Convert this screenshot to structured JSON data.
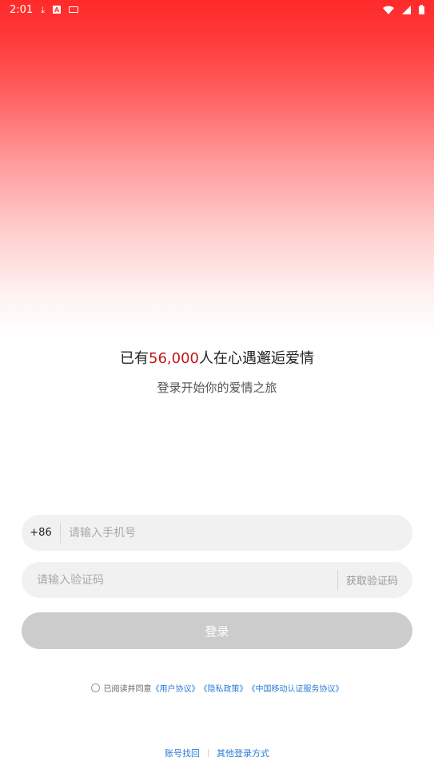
{
  "status_bar": {
    "time": "2:01",
    "icons": [
      "download-icon",
      "a-icon",
      "keyboard-icon",
      "wifi-icon",
      "signal-icon",
      "battery-icon"
    ]
  },
  "headline": {
    "prefix": "已有",
    "count": "56,000",
    "suffix": "人在心遇邂逅爱情"
  },
  "subline": "登录开始你的爱情之旅",
  "phone": {
    "prefix": "+86",
    "placeholder": "请输入手机号",
    "value": ""
  },
  "code": {
    "placeholder": "请输入验证码",
    "value": "",
    "get_code_label": "获取验证码"
  },
  "login_label": "登录",
  "agreement": {
    "text": "已阅读并同意",
    "links": [
      "《用户协议》",
      "《隐私政策》",
      "《中国移动认证服务协议》"
    ]
  },
  "footer": {
    "recover": "账号找回",
    "other_login": "其他登录方式"
  },
  "colors": {
    "accent": "#c4161c",
    "link": "#2c7cd6",
    "button_disabled": "#cccccc"
  }
}
